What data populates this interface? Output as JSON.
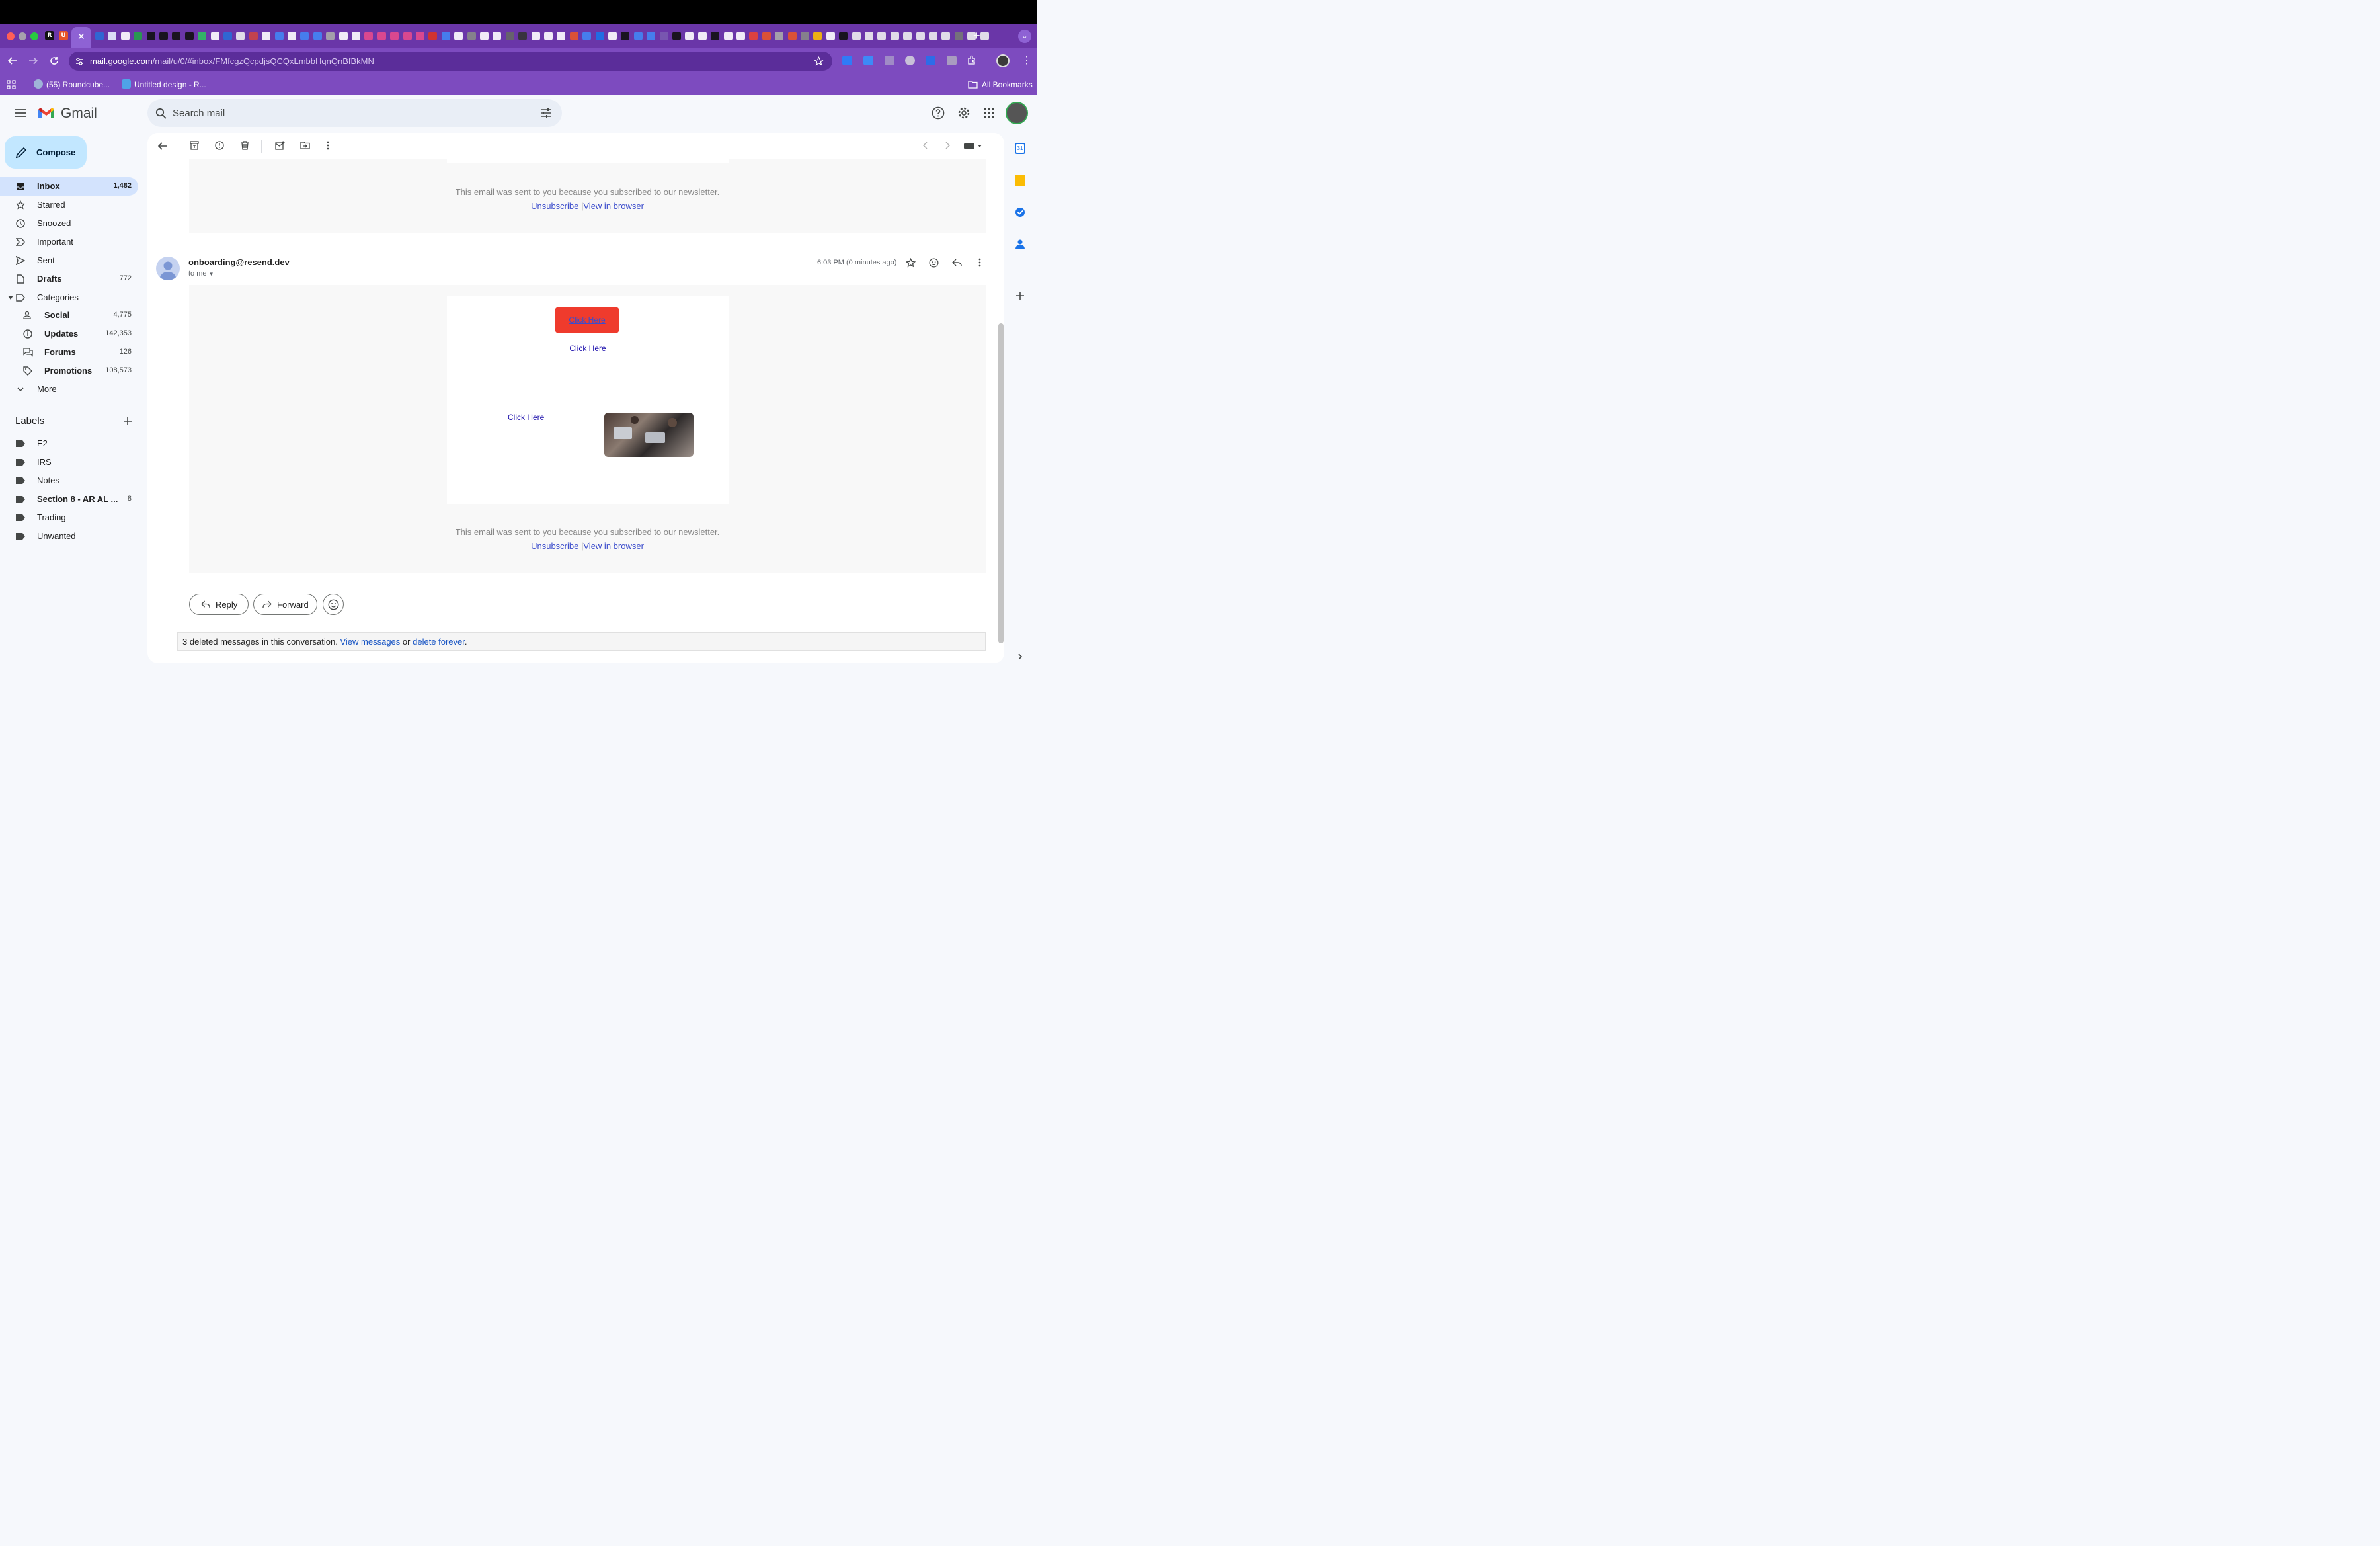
{
  "browser": {
    "url_host": "mail.google.com",
    "url_path": "/mail/u/0/#inbox/FMfcgzQcpdjsQCQxLmbbHqnQnBfBkMN",
    "bookmarks": [
      {
        "label": "(55) Roundcube..."
      },
      {
        "label": "Untitled design - R..."
      }
    ],
    "all_bookmarks": "All Bookmarks"
  },
  "gmail": {
    "logo_text": "Gmail",
    "search_placeholder": "Search mail",
    "compose_label": "Compose"
  },
  "nav": {
    "inbox": {
      "label": "Inbox",
      "count": "1,482"
    },
    "starred": {
      "label": "Starred"
    },
    "snoozed": {
      "label": "Snoozed"
    },
    "important": {
      "label": "Important"
    },
    "sent": {
      "label": "Sent"
    },
    "drafts": {
      "label": "Drafts",
      "count": "772"
    },
    "categories": {
      "label": "Categories"
    },
    "social": {
      "label": "Social",
      "count": "4,775"
    },
    "updates": {
      "label": "Updates",
      "count": "142,353"
    },
    "forums": {
      "label": "Forums",
      "count": "126"
    },
    "promotions": {
      "label": "Promotions",
      "count": "108,573"
    },
    "more": {
      "label": "More"
    }
  },
  "labels": {
    "heading": "Labels",
    "items": [
      {
        "label": "E2",
        "count": ""
      },
      {
        "label": "IRS",
        "count": ""
      },
      {
        "label": "Notes",
        "count": ""
      },
      {
        "label": "Section 8 - AR AL ...",
        "count": "8"
      },
      {
        "label": "Trading",
        "count": ""
      },
      {
        "label": "Unwanted",
        "count": ""
      }
    ]
  },
  "message_prev": {
    "footer": "This email was sent to you because you subscribed to our newsletter.",
    "unsubscribe": "Unsubscribe",
    "separator": "|",
    "view_in_browser": "View in browser"
  },
  "message": {
    "sender": "onboarding@resend.dev",
    "to": "to me",
    "time": "6:03 PM (0 minutes ago)",
    "button1": "Click Here",
    "link1": "Click Here",
    "link2": "Click Here",
    "footer": "This email was sent to you because you subscribed to our newsletter.",
    "unsubscribe": "Unsubscribe",
    "separator": "|",
    "view_in_browser": "View in browser"
  },
  "actions": {
    "reply": "Reply",
    "forward": "Forward"
  },
  "deleted_notice": {
    "text": "3 deleted messages in this conversation.",
    "view": "View messages",
    "or": "or",
    "delete": "delete forever",
    "period": "."
  },
  "colors": {
    "tabstrip": "#6a36a8",
    "toolbar": "#7d4bbf",
    "compose": "#c2e7ff",
    "active_nav": "#d3e3fd",
    "email_button": "#ef3b2d",
    "link": "#3c4dcc"
  }
}
